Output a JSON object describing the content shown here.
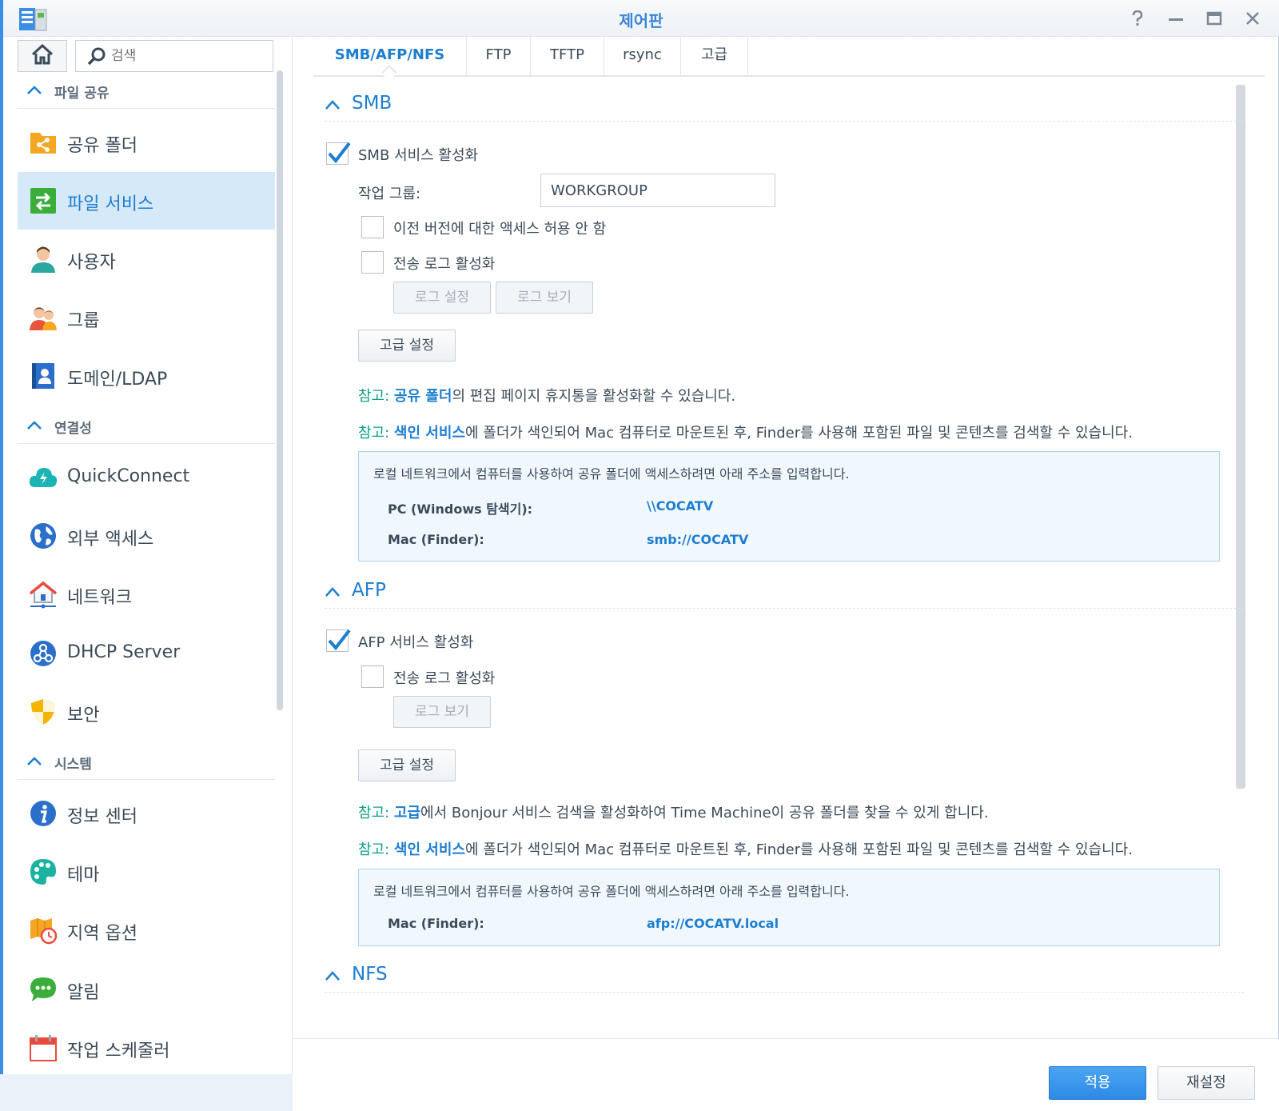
{
  "window": {
    "title": "제어판"
  },
  "sidebar": {
    "search_placeholder": "검색",
    "groups": [
      {
        "label": "파일 공유"
      },
      {
        "label": "연결성"
      },
      {
        "label": "시스템"
      }
    ],
    "items": [
      {
        "label": "공유 폴더",
        "icon": "shared-folder-icon"
      },
      {
        "label": "파일 서비스",
        "icon": "file-services-icon",
        "active": true
      },
      {
        "label": "사용자",
        "icon": "user-icon"
      },
      {
        "label": "그룹",
        "icon": "group-icon"
      },
      {
        "label": "도메인/LDAP",
        "icon": "domain-ldap-icon"
      },
      {
        "label": "QuickConnect",
        "icon": "quickconnect-icon"
      },
      {
        "label": "외부 액세스",
        "icon": "external-access-icon"
      },
      {
        "label": "네트워크",
        "icon": "network-icon"
      },
      {
        "label": "DHCP Server",
        "icon": "dhcp-icon"
      },
      {
        "label": "보안",
        "icon": "security-shield-icon"
      },
      {
        "label": "정보 센터",
        "icon": "info-icon"
      },
      {
        "label": "테마",
        "icon": "theme-palette-icon"
      },
      {
        "label": "지역 옵션",
        "icon": "regional-options-icon"
      },
      {
        "label": "알림",
        "icon": "notification-icon"
      },
      {
        "label": "작업 스케줄러",
        "icon": "task-scheduler-icon"
      }
    ]
  },
  "tabs": [
    {
      "label": "SMB/AFP/NFS",
      "active": true
    },
    {
      "label": "FTP"
    },
    {
      "label": "TFTP"
    },
    {
      "label": "rsync"
    },
    {
      "label": "고급"
    }
  ],
  "smb": {
    "heading": "SMB",
    "enable_label": "SMB 서비스 활성화",
    "enable_checked": true,
    "workgroup_label": "작업 그룹:",
    "workgroup_value": "WORKGROUP",
    "prev_version_label": "이전 버전에 대한 액세스 허용 안 함",
    "transfer_log_label": "전송 로그 활성화",
    "log_settings_btn": "로그 설정",
    "log_view_btn": "로그 보기",
    "advanced_btn": "고급 설정",
    "note1": {
      "prefix": "참고:",
      "link": "공유 폴더",
      "rest": "의 편집 페이지 휴지통을 활성화할 수 있습니다."
    },
    "note2": {
      "prefix": "참고:",
      "link": "색인 서비스",
      "rest": "에 폴더가 색인되어 Mac 컴퓨터로 마운트된 후, Finder를 사용해 포함된 파일 및 콘텐츠를 검색할 수 있습니다."
    },
    "info": {
      "desc": "로컬 네트워크에서 컴퓨터를 사용하여 공유 폴더에 액세스하려면 아래 주소를 입력합니다.",
      "pc_label": "PC (Windows 탐색기):",
      "pc_value": "\\\\COCATV",
      "mac_label": "Mac (Finder):",
      "mac_value": "smb://COCATV"
    }
  },
  "afp": {
    "heading": "AFP",
    "enable_label": "AFP 서비스 활성화",
    "enable_checked": true,
    "transfer_log_label": "전송 로그 활성화",
    "log_view_btn": "로그 보기",
    "advanced_btn": "고급 설정",
    "note1": {
      "prefix": "참고:",
      "link": "고급",
      "rest": "에서 Bonjour 서비스 검색을 활성화하여 Time Machine이 공유 폴더를 찾을 수 있게 합니다."
    },
    "note2": {
      "prefix": "참고:",
      "link": "색인 서비스",
      "rest": "에 폴더가 색인되어 Mac 컴퓨터로 마운트된 후, Finder를 사용해 포함된 파일 및 콘텐츠를 검색할 수 있습니다."
    },
    "info": {
      "desc": "로컬 네트워크에서 컴퓨터를 사용하여 공유 폴더에 액세스하려면 아래 주소를 입력합니다.",
      "mac_label": "Mac (Finder):",
      "mac_value": "afp://COCATV.local"
    }
  },
  "nfs": {
    "heading": "NFS"
  },
  "footer": {
    "apply": "적용",
    "reset": "재설정"
  },
  "colors": {
    "accent": "#1d7ed0",
    "note": "#0c9e86",
    "active_bg": "#d6e9f8",
    "apply_btn": "#2d8ae4"
  }
}
